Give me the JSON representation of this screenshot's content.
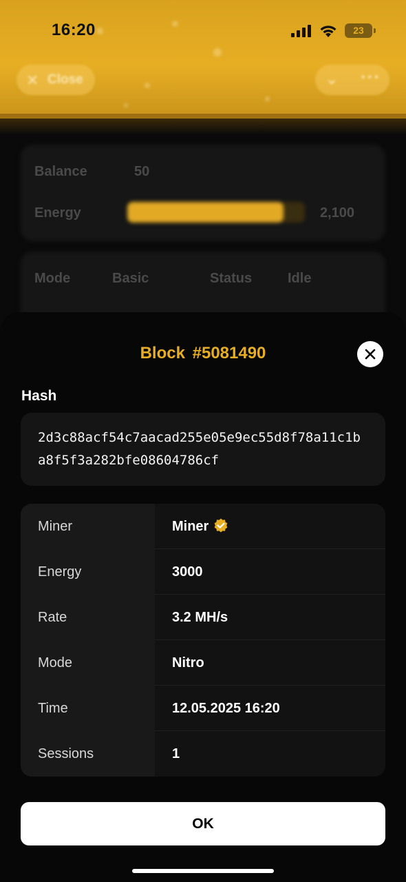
{
  "status_bar": {
    "time": "16:20",
    "battery": "23",
    "signal_icon": "signal-bars-icon",
    "wifi_icon": "wifi-icon"
  },
  "header": {
    "close_label": "Close",
    "close_icon": "close-icon",
    "collapse_icon": "chevron-down-icon",
    "more_icon": "more-dots-icon"
  },
  "background": {
    "card1": {
      "balance_label": "Balance",
      "balance_value": "50",
      "energy_label": "Energy",
      "energy_value": "2,100",
      "energy_fill": 0.88
    },
    "card2": {
      "columns": [
        "Mode",
        "Basic",
        "Status",
        "Idle"
      ]
    }
  },
  "modal": {
    "title": "Block #5081490",
    "hash_label": "Hash",
    "hash_value": "2d3c88acf54c7aacad255e05e9ec55d8f78a11c1ba8f5f3a282bfe08604786cf",
    "rows": [
      {
        "key": "Miner",
        "value": "Miner"
      },
      {
        "key": "Energy",
        "value": "3000"
      },
      {
        "key": "Rate",
        "value": "3.2 MH/s"
      },
      {
        "key": "Mode",
        "value": "Nitro"
      },
      {
        "key": "Time",
        "value": "12.05.2025 16:20"
      },
      {
        "key": "Sessions",
        "value": "1"
      }
    ],
    "ok_label": "OK"
  },
  "colors": {
    "accent": "#e7ae24",
    "sheet_bg": "#070707",
    "row_key_bg": "#191919",
    "row_val_bg": "#121212"
  }
}
